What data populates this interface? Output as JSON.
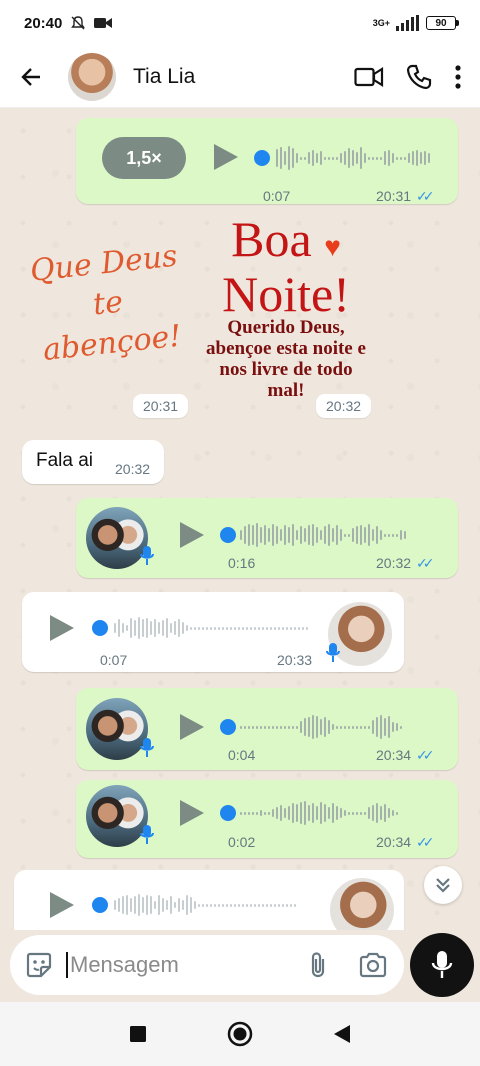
{
  "status_bar": {
    "time": "20:40",
    "network": "3G+",
    "battery": "90"
  },
  "header": {
    "contact_name": "Tia Lia"
  },
  "messages": [
    {
      "kind": "voice",
      "direction": "out",
      "speed": "1,5×",
      "duration": "0:07",
      "time": "20:31"
    },
    {
      "kind": "sticker",
      "text_left": "Que Deus te abençoe!",
      "text_boa": "Boa",
      "text_noite": "Noite!",
      "text_body": "Querido Deus, abençoe esta noite e nos livre de todo mal!",
      "time_left": "20:31",
      "time_right": "20:32"
    },
    {
      "kind": "text",
      "direction": "in",
      "text": "Fala ai",
      "time": "20:32"
    },
    {
      "kind": "voice",
      "direction": "out",
      "duration": "0:16",
      "time": "20:32"
    },
    {
      "kind": "voice",
      "direction": "in",
      "duration": "0:07",
      "time": "20:33"
    },
    {
      "kind": "voice",
      "direction": "out",
      "duration": "0:04",
      "time": "20:34"
    },
    {
      "kind": "voice",
      "direction": "out",
      "duration": "0:02",
      "time": "20:34"
    },
    {
      "kind": "voice",
      "direction": "in"
    }
  ],
  "composer": {
    "placeholder": "Mensagem"
  }
}
